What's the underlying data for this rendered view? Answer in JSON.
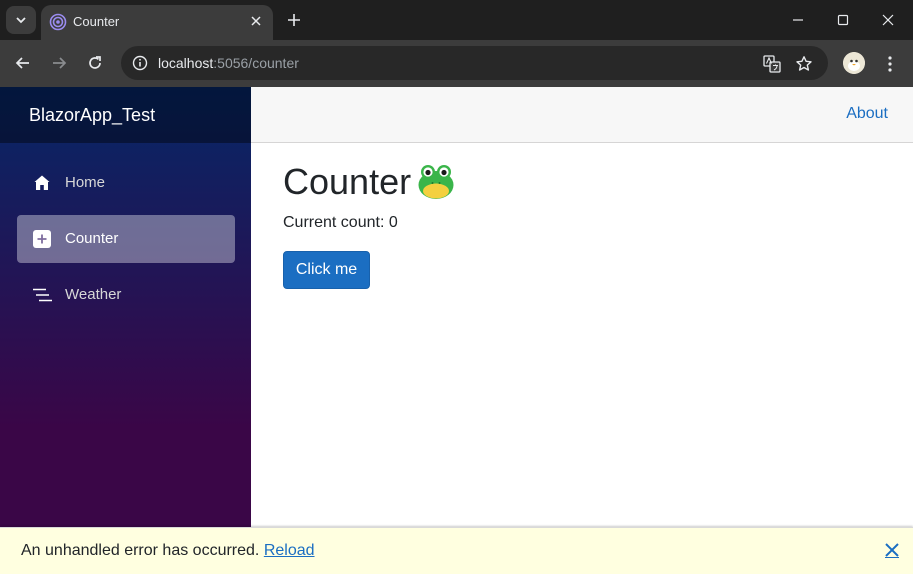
{
  "browser": {
    "tab_title": "Counter",
    "url_host": "localhost",
    "url_rest": ":5056/counter",
    "icons": {
      "tab_search": "chevron-down-icon",
      "favicon": "blazor-icon",
      "tab_close": "close-icon",
      "new_tab": "plus-icon",
      "minimize": "minimize-icon",
      "maximize": "maximize-icon",
      "close": "close-icon",
      "back": "arrow-left-icon",
      "forward": "arrow-right-icon",
      "reload": "reload-icon",
      "site_info": "info-icon",
      "translate": "translate-icon",
      "bookmark": "star-icon",
      "profile": "avatar",
      "menu": "kebab-menu-icon"
    }
  },
  "sidebar": {
    "brand": "BlazorApp_Test",
    "items": [
      {
        "label": "Home",
        "icon": "home-icon",
        "active": false
      },
      {
        "label": "Counter",
        "icon": "plus-square-icon",
        "active": true
      },
      {
        "label": "Weather",
        "icon": "list-icon",
        "active": false
      }
    ]
  },
  "header": {
    "about": "About"
  },
  "main": {
    "title": "Counter",
    "title_emoji": "frog-emoji",
    "count_label": "Current count: 0",
    "button_label": "Click me"
  },
  "error_bar": {
    "message": "An unhandled error has occurred.",
    "reload": "Reload",
    "dismiss": "🗙"
  },
  "colors": {
    "accent": "#1b6ec2",
    "sidebar_top": "#052767",
    "sidebar_bottom": "#3a0647",
    "error_bg": "#ffffe0"
  }
}
